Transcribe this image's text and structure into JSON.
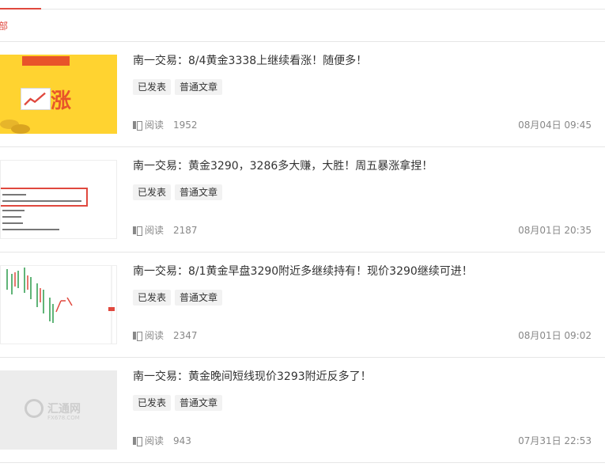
{
  "filter": {
    "label": "部"
  },
  "articles": [
    {
      "title": "南一交易：8/4黄金3338上继续看涨！随便多！",
      "tags": [
        "已发表",
        "普通文章"
      ],
      "read_label": "阅读",
      "read_count": "1952",
      "date": "08月04日 09:45",
      "thumb_text": "涨"
    },
    {
      "title": "南一交易：黄金3290，3286多大赚，大胜！周五暴涨拿捏！",
      "tags": [
        "已发表",
        "普通文章"
      ],
      "read_label": "阅读",
      "read_count": "2187",
      "date": "08月01日 20:35"
    },
    {
      "title": "南一交易：8/1黄金早盘3290附近多继续持有！现价3290继续可进！",
      "tags": [
        "已发表",
        "普通文章"
      ],
      "read_label": "阅读",
      "read_count": "2347",
      "date": "08月01日 09:02"
    },
    {
      "title": "南一交易：黄金晚间短线现价3293附近反多了！",
      "tags": [
        "已发表",
        "普通文章"
      ],
      "read_label": "阅读",
      "read_count": "943",
      "date": "07月31日 22:53",
      "thumb_logo": "汇通网",
      "thumb_logo_sub": "FX678.COM"
    }
  ],
  "colors": {
    "accent": "#e0483e",
    "tag_bg": "#f2f2f2",
    "meta": "#888888"
  },
  "icons": {
    "read": "book-icon"
  }
}
